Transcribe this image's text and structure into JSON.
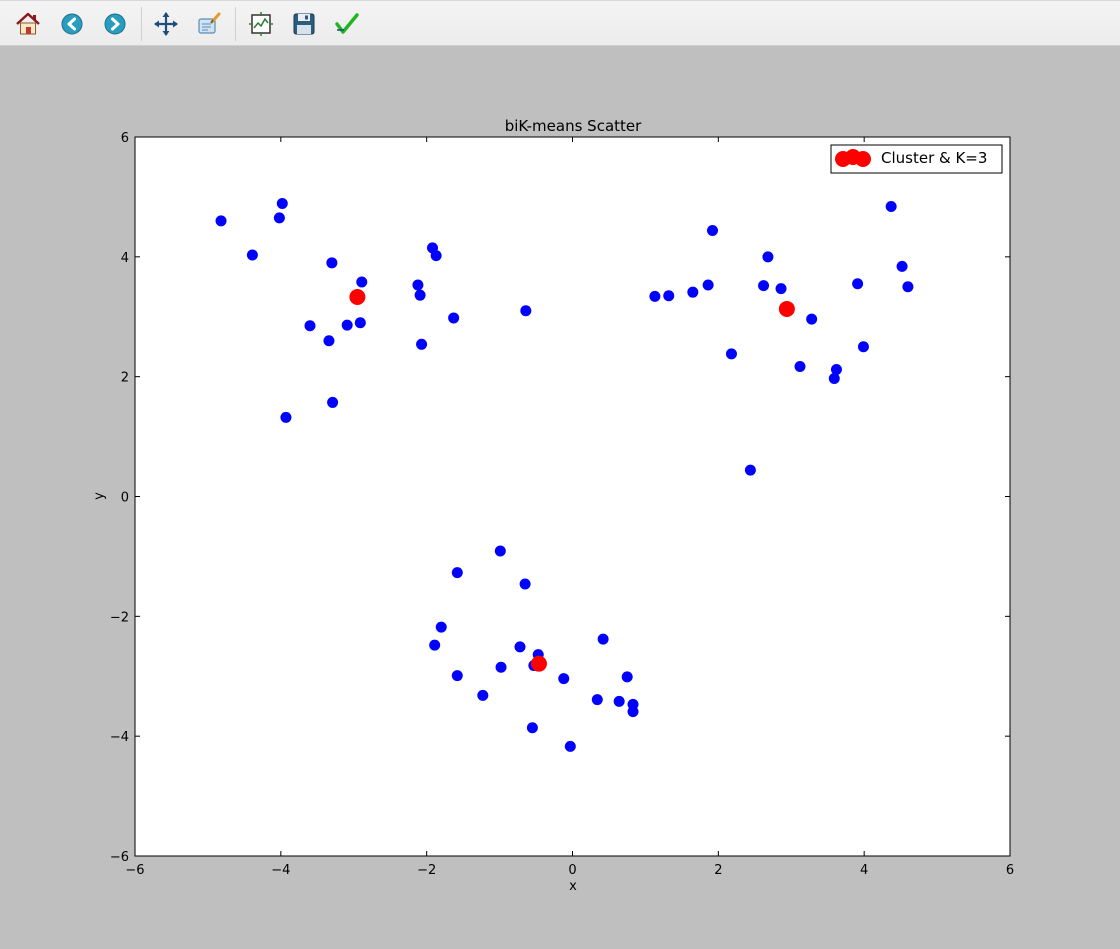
{
  "toolbar": {
    "buttons": [
      {
        "icon": "home-icon",
        "tooltip": "Reset original view"
      },
      {
        "icon": "back-arrow-icon",
        "tooltip": "Back to previous view"
      },
      {
        "icon": "forward-arrow-icon",
        "tooltip": "Forward to next view"
      },
      {
        "icon": "pan-icon",
        "tooltip": "Pan axes"
      },
      {
        "icon": "zoom-icon",
        "tooltip": "Zoom to rectangle"
      },
      {
        "icon": "subplots-icon",
        "tooltip": "Configure subplots"
      },
      {
        "icon": "save-icon",
        "tooltip": "Save the figure"
      },
      {
        "icon": "checkmark-icon",
        "tooltip": "Edit parameters"
      }
    ]
  },
  "chart_data": {
    "type": "scatter",
    "title": "biK-means Scatter",
    "xlabel": "x",
    "ylabel": "y",
    "xlim": [
      -6,
      6
    ],
    "ylim": [
      -6,
      6
    ],
    "xticks": [
      -6,
      -4,
      -2,
      0,
      2,
      4,
      6
    ],
    "yticks": [
      -6,
      -4,
      -2,
      0,
      2,
      4,
      6
    ],
    "grid": false,
    "legend": {
      "position": "top-right",
      "entries": [
        "Cluster & K=3"
      ]
    },
    "series": [
      {
        "color": "#0000ff",
        "points": [
          [
            -4.82,
            4.6
          ],
          [
            -4.02,
            4.65
          ],
          [
            -3.98,
            4.89
          ],
          [
            -4.39,
            4.03
          ],
          [
            -3.3,
            3.9
          ],
          [
            -2.89,
            3.58
          ],
          [
            -3.6,
            2.85
          ],
          [
            -3.09,
            2.86
          ],
          [
            -2.91,
            2.9
          ],
          [
            -3.34,
            2.6
          ],
          [
            -3.29,
            1.57
          ],
          [
            -3.93,
            1.32
          ],
          [
            -1.92,
            4.15
          ],
          [
            -1.87,
            4.02
          ],
          [
            -2.12,
            3.53
          ],
          [
            -2.09,
            3.36
          ],
          [
            -1.63,
            2.98
          ],
          [
            -2.07,
            2.54
          ],
          [
            -0.64,
            3.1
          ],
          [
            1.13,
            3.34
          ],
          [
            1.32,
            3.35
          ],
          [
            1.65,
            3.41
          ],
          [
            1.86,
            3.53
          ],
          [
            1.92,
            4.44
          ],
          [
            2.68,
            4.0
          ],
          [
            2.62,
            3.52
          ],
          [
            2.86,
            3.47
          ],
          [
            3.28,
            2.96
          ],
          [
            2.18,
            2.38
          ],
          [
            3.12,
            2.17
          ],
          [
            3.62,
            2.12
          ],
          [
            3.59,
            1.97
          ],
          [
            3.91,
            3.55
          ],
          [
            3.99,
            2.5
          ],
          [
            4.37,
            4.84
          ],
          [
            4.52,
            3.84
          ],
          [
            4.6,
            3.5
          ],
          [
            2.44,
            0.44
          ],
          [
            -0.99,
            -0.91
          ],
          [
            -1.58,
            -1.27
          ],
          [
            -0.65,
            -1.46
          ],
          [
            -1.8,
            -2.18
          ],
          [
            -1.89,
            -2.48
          ],
          [
            -0.72,
            -2.51
          ],
          [
            -0.47,
            -2.64
          ],
          [
            -0.53,
            -2.82
          ],
          [
            -0.98,
            -2.85
          ],
          [
            -1.58,
            -2.99
          ],
          [
            -1.23,
            -3.32
          ],
          [
            -0.12,
            -3.04
          ],
          [
            0.42,
            -2.38
          ],
          [
            0.75,
            -3.01
          ],
          [
            0.34,
            -3.39
          ],
          [
            0.64,
            -3.42
          ],
          [
            0.83,
            -3.47
          ],
          [
            0.83,
            -3.59
          ],
          [
            -0.55,
            -3.86
          ],
          [
            -0.03,
            -4.17
          ]
        ]
      },
      {
        "name": "Cluster & K=3",
        "color": "#ff0000",
        "points": [
          [
            -2.95,
            3.33
          ],
          [
            2.94,
            3.13
          ],
          [
            -0.46,
            -2.79
          ]
        ]
      }
    ]
  }
}
